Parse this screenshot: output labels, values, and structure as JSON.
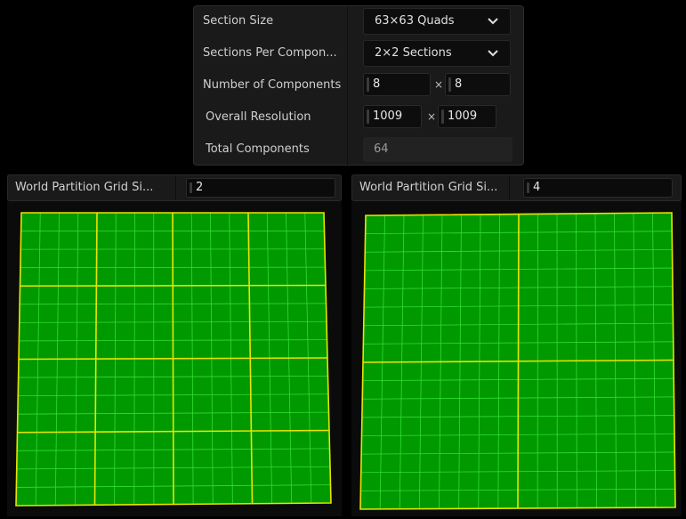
{
  "settings": {
    "section_size": {
      "label": "Section Size",
      "value": "63×63 Quads"
    },
    "sections_per_component": {
      "label": "Sections Per Compon...",
      "value": "2×2 Sections"
    },
    "number_of_components": {
      "label": "Number of Components",
      "x": "8",
      "y": "8",
      "times": "×"
    },
    "overall_resolution": {
      "label": "Overall Resolution",
      "x": "1009",
      "y": "1009",
      "times": "×"
    },
    "total_components": {
      "label": "Total Components",
      "value": "64"
    }
  },
  "left_grid": {
    "label": "World Partition Grid Si...",
    "value": "2",
    "fill": "#009900",
    "minor_line": "#33dd33",
    "major_line": "#e6e600",
    "major_divisions": 4,
    "minor_per_major": 4
  },
  "right_grid": {
    "label": "World Partition Grid Si...",
    "value": "4",
    "fill": "#009900",
    "minor_line": "#33dd33",
    "major_line": "#e6e600",
    "major_divisions": 2,
    "minor_per_major": 8
  }
}
